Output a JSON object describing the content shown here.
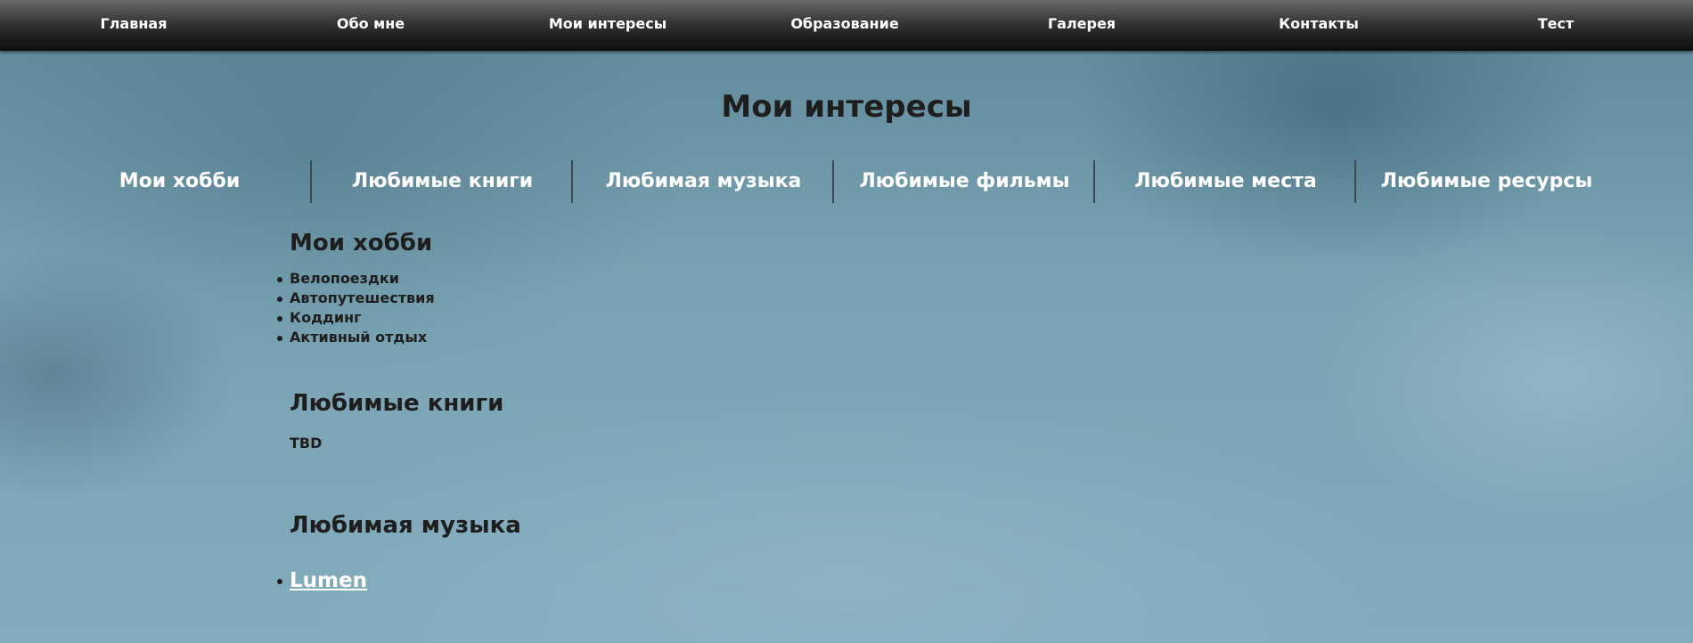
{
  "top_nav": {
    "items": [
      {
        "label": "Главная"
      },
      {
        "label": "Обо мне"
      },
      {
        "label": "Мои интересы"
      },
      {
        "label": "Образование"
      },
      {
        "label": "Галерея"
      },
      {
        "label": "Контакты"
      },
      {
        "label": "Тест"
      }
    ]
  },
  "page": {
    "title": "Мои интересы"
  },
  "sub_tabs": [
    {
      "label": "Мои хобби"
    },
    {
      "label": "Любимые книги"
    },
    {
      "label": "Любимая музыка"
    },
    {
      "label": "Любимые фильмы"
    },
    {
      "label": "Любимые места"
    },
    {
      "label": "Любимые ресурсы"
    }
  ],
  "sections": {
    "hobbies": {
      "title": "Мои хобби",
      "items": [
        "Велопоездки",
        "Автопутешествия",
        "Коддинг",
        "Активный отдых"
      ]
    },
    "books": {
      "title": "Любимые книги",
      "text": "TBD"
    },
    "music": {
      "title": "Любимая музыка",
      "link": "Lumen"
    }
  },
  "colors": {
    "nav_bg": "#1c1c1c",
    "nav_text": "#ffffff",
    "heading_text": "#1e1e1e",
    "tab_text": "#ffffff",
    "link_text": "#ffffff",
    "background": "#6f98a9"
  }
}
